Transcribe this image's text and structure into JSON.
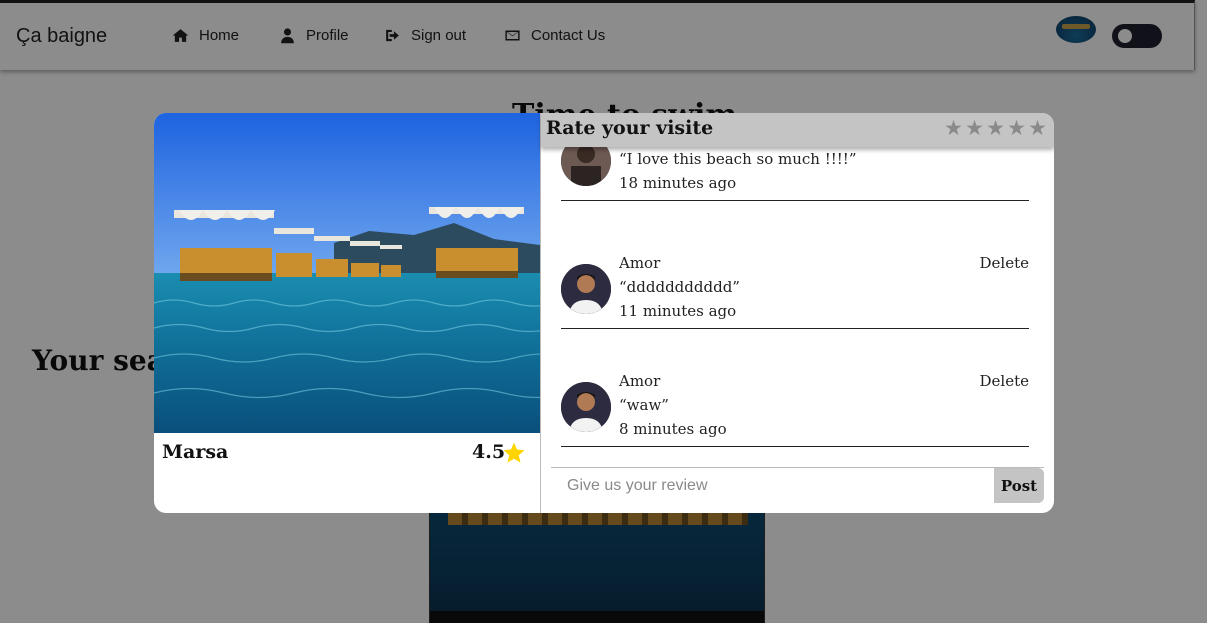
{
  "navbar": {
    "brand": "Ça baigne",
    "items": [
      {
        "label": "Home",
        "icon": "home-icon"
      },
      {
        "label": "Profile",
        "icon": "user-icon"
      },
      {
        "label": "Sign out",
        "icon": "sign-out-icon"
      },
      {
        "label": "Contact Us",
        "icon": "envelope-icon"
      }
    ]
  },
  "background": {
    "heading_top": "Time to swim",
    "heading_left": "Your search"
  },
  "modal": {
    "beach": {
      "name": "Marsa",
      "rating": "4.5"
    },
    "rate": {
      "title": "Rate your visite",
      "stars": [
        "★",
        "★",
        "★",
        "★",
        "★"
      ]
    },
    "reviews": [
      {
        "author": "",
        "text": "“I love this beach so much !!!!”",
        "time": "18 minutes ago",
        "delete": ""
      },
      {
        "author": "Amor",
        "text": "“ddddddddddd”",
        "time": "11 minutes ago",
        "delete": "Delete"
      },
      {
        "author": "Amor",
        "text": "“waw”",
        "time": "8 minutes ago",
        "delete": "Delete"
      }
    ],
    "input": {
      "placeholder": "Give us your review",
      "post_label": "Post"
    }
  },
  "colors": {
    "star_active": "#ffd400",
    "header_bg": "#c4c4c4",
    "overlay": "rgba(0,0,0,0.45)"
  }
}
